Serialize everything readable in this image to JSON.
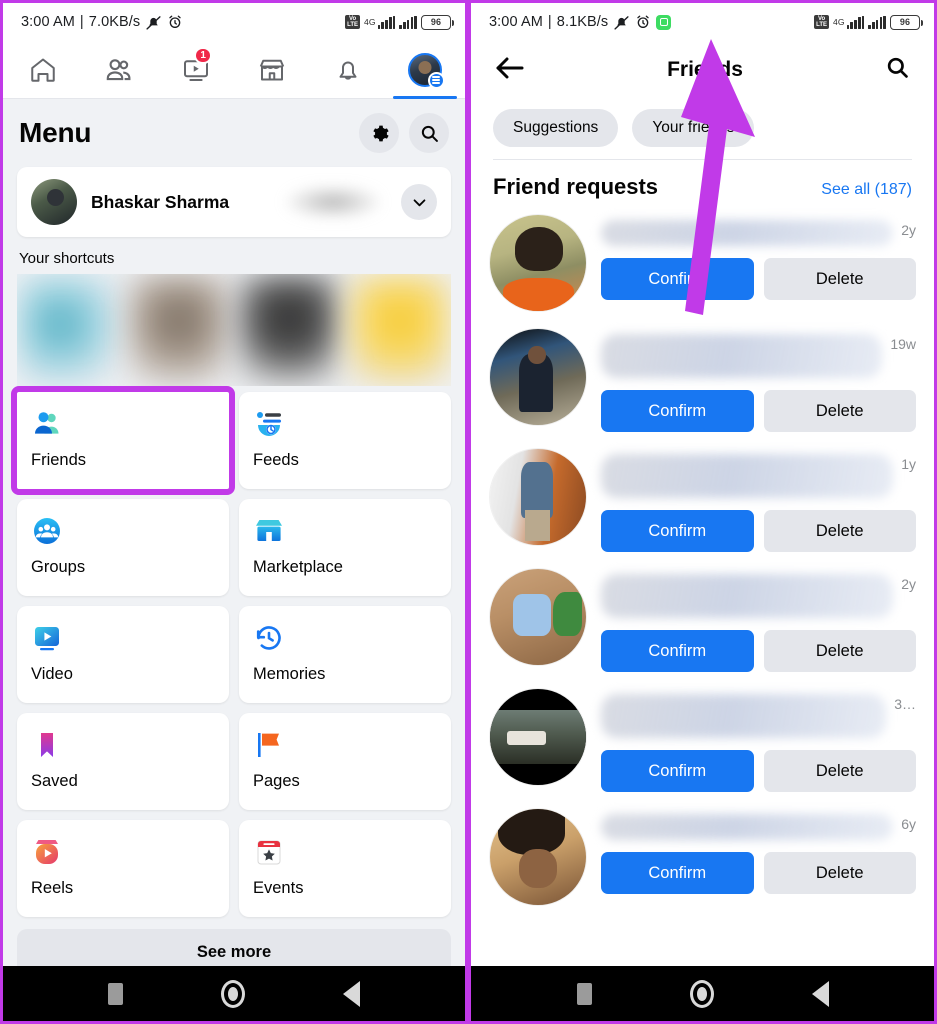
{
  "left_phone": {
    "status_bar": {
      "time": "3:00 AM",
      "separator": "|",
      "net_speed": "7.0KB/s",
      "mute_icon": "bell-muted-icon",
      "alarm_icon": "alarm-clock-icon",
      "volte_label_top": "Vo",
      "volte_label_bottom": "LTE",
      "network_type": "4G",
      "battery_level": "96"
    },
    "topnav": [
      {
        "name": "home-tab",
        "icon": "home-icon",
        "badge": "",
        "active": false
      },
      {
        "name": "friends-tab",
        "icon": "people-icon",
        "badge": "",
        "active": false
      },
      {
        "name": "video-tab",
        "icon": "video-screen-icon",
        "badge": "1",
        "active": false
      },
      {
        "name": "marketplace-tab",
        "icon": "storefront-icon",
        "badge": "",
        "active": false
      },
      {
        "name": "notifications-tab",
        "icon": "bell-icon",
        "badge": "",
        "active": false
      },
      {
        "name": "menu-profile-tab",
        "icon": "profile-avatar-icon",
        "badge": "",
        "active": true
      }
    ],
    "menu": {
      "title": "Menu",
      "settings_icon": "gear-icon",
      "search_icon": "search-icon",
      "profile": {
        "name": "Bhaskar Sharma",
        "chevron_icon": "chevron-down-icon"
      },
      "shortcuts_label": "Your shortcuts",
      "tiles": [
        {
          "label": "Friends",
          "icon": "friends-icon",
          "highlighted": true
        },
        {
          "label": "Feeds",
          "icon": "feeds-icon",
          "highlighted": false
        },
        {
          "label": "Groups",
          "icon": "groups-icon",
          "highlighted": false
        },
        {
          "label": "Marketplace",
          "icon": "marketplace-icon",
          "highlighted": false
        },
        {
          "label": "Video",
          "icon": "video-icon",
          "highlighted": false
        },
        {
          "label": "Memories",
          "icon": "memories-clock-icon",
          "highlighted": false
        },
        {
          "label": "Saved",
          "icon": "bookmark-icon",
          "highlighted": false
        },
        {
          "label": "Pages",
          "icon": "flag-icon",
          "highlighted": false
        },
        {
          "label": "Reels",
          "icon": "reels-icon",
          "highlighted": false
        },
        {
          "label": "Events",
          "icon": "calendar-star-icon",
          "highlighted": false
        }
      ],
      "see_more_label": "See more"
    }
  },
  "right_phone": {
    "status_bar": {
      "time": "3:00 AM",
      "separator": "|",
      "net_speed": "8.1KB/s",
      "mute_icon": "bell-muted-icon",
      "alarm_icon": "alarm-clock-icon",
      "app_icon": "green-app-icon",
      "volte_label_top": "Vo",
      "volte_label_bottom": "LTE",
      "network_type": "4G",
      "battery_level": "96"
    },
    "header": {
      "back_icon": "back-arrow-icon",
      "title": "Friends",
      "search_icon": "search-icon"
    },
    "chips": [
      {
        "label": "Suggestions",
        "name": "chip-suggestions"
      },
      {
        "label": "Your friends",
        "name": "chip-your-friends"
      }
    ],
    "section": {
      "title": "Friend requests",
      "see_all_label": "See all (187)"
    },
    "requests": [
      {
        "time": "2y",
        "confirm": "Confirm",
        "delete": "Delete",
        "name_blur": "short"
      },
      {
        "time": "19w",
        "confirm": "Confirm",
        "delete": "Delete",
        "name_blur": "tall"
      },
      {
        "time": "1y",
        "confirm": "Confirm",
        "delete": "Delete",
        "name_blur": "tall"
      },
      {
        "time": "2y",
        "confirm": "Confirm",
        "delete": "Delete",
        "name_blur": "tall"
      },
      {
        "time": "3…",
        "confirm": "Confirm",
        "delete": "Delete",
        "name_blur": "tall"
      },
      {
        "time": "6y",
        "confirm": "Confirm",
        "delete": "Delete",
        "name_blur": "short"
      }
    ]
  },
  "android_navbar": {
    "recents_icon": "recents-square-icon",
    "home_icon": "home-circle-icon",
    "back_icon": "back-triangle-icon"
  },
  "annotation": {
    "highlight_color": "#c13ae8",
    "arrow_color": "#c13ae8",
    "arrow_target": "Your friends"
  },
  "colors": {
    "facebook_blue": "#1877f2",
    "badge_red": "#f02849",
    "surface": "#f0f2f5",
    "chip_grey": "#e4e6eb"
  }
}
